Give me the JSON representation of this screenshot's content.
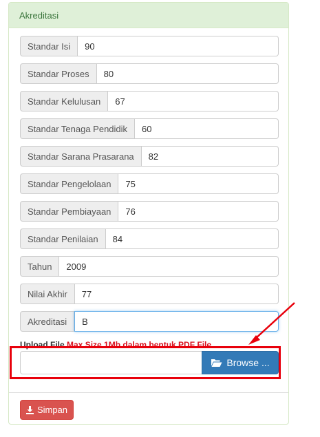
{
  "panel": {
    "title": "Akreditasi"
  },
  "fields": [
    {
      "label": "Standar Isi",
      "value": "90"
    },
    {
      "label": "Standar Proses",
      "value": "80"
    },
    {
      "label": "Standar Kelulusan",
      "value": "67"
    },
    {
      "label": "Standar Tenaga Pendidik",
      "value": "60"
    },
    {
      "label": "Standar Sarana Prasarana",
      "value": "82"
    },
    {
      "label": "Standar Pengelolaan",
      "value": "75"
    },
    {
      "label": "Standar Pembiayaan",
      "value": "76"
    },
    {
      "label": "Standar Penilaian",
      "value": "84"
    },
    {
      "label": "Tahun",
      "value": "2009"
    },
    {
      "label": "Nilai Akhir",
      "value": "77"
    },
    {
      "label": "Akreditasi",
      "value": "B"
    }
  ],
  "upload": {
    "label": "Upload File",
    "hint": "Max Size 1Mb dalam bentuk PDF File",
    "browse_label": "Browse ...",
    "browse_icon": "folder-open-icon"
  },
  "actions": {
    "save_label": "Simpan",
    "save_icon": "download-icon"
  },
  "colors": {
    "heading_bg": "#dff0d8",
    "heading_text": "#3c763d",
    "primary": "#337ab7",
    "danger": "#d9534f",
    "annotation_red": "#e8000b"
  }
}
